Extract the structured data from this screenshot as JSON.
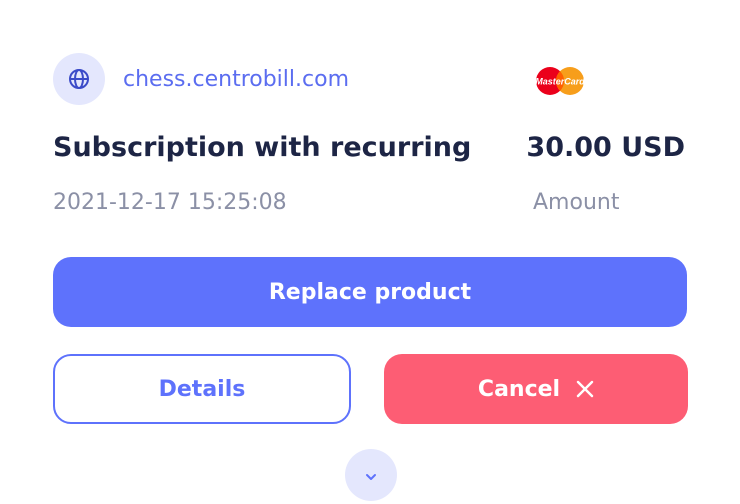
{
  "site": {
    "icon": "globe-icon",
    "domain": "chess.centrobill.com"
  },
  "payment": {
    "card_brand": "MasterCard",
    "card_icon": "mastercard-logo"
  },
  "product": {
    "title": "Subscription with recurring",
    "datetime": "2021-12-17 15:25:08"
  },
  "amount": {
    "value": "30.00 USD",
    "label": "Amount"
  },
  "actions": {
    "replace_label": "Replace product",
    "details_label": "Details",
    "cancel_label": "Cancel",
    "cancel_icon": "close-icon",
    "expand_icon": "chevron-down-icon"
  },
  "colors": {
    "primary": "#5e72fc",
    "danger": "#fd5d74",
    "icon_bg": "#e4e7fd",
    "title": "#1d2545",
    "muted": "#8b90a6"
  }
}
